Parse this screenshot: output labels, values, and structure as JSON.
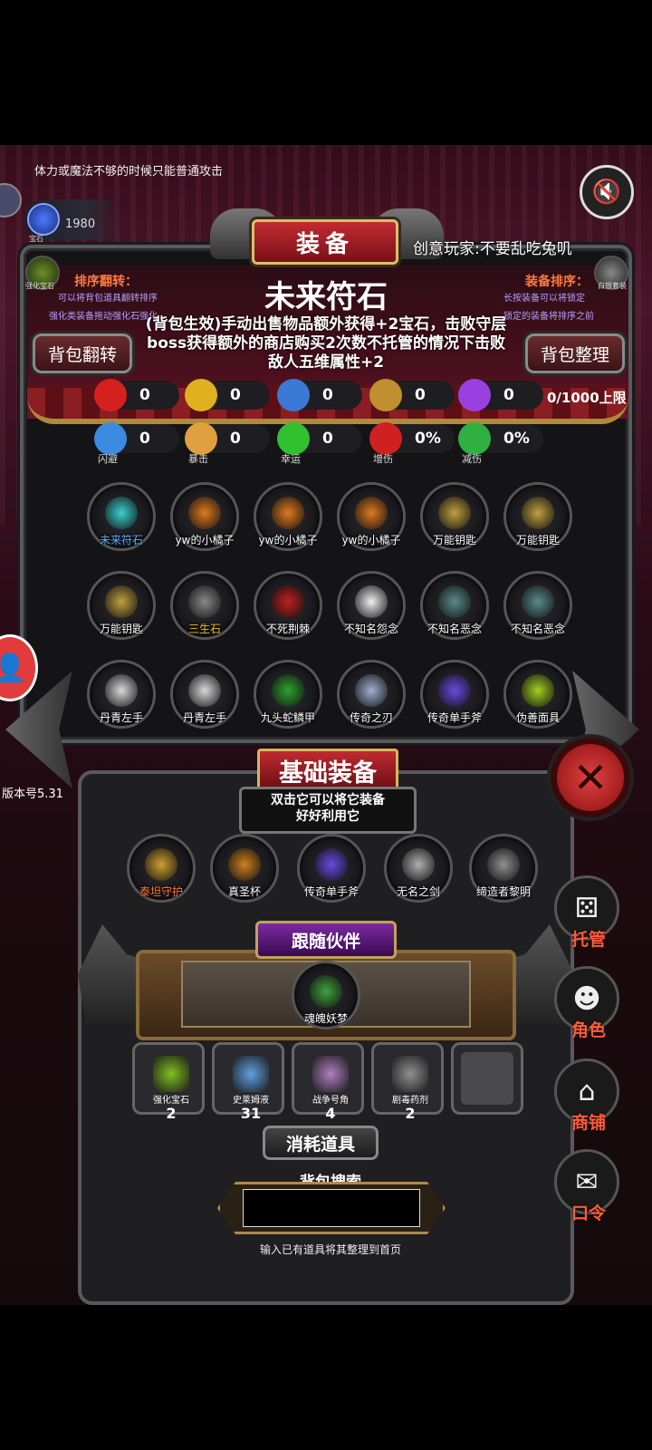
{
  "hint": "体力或魔法不够的时候只能普通攻击",
  "currency": {
    "count": "1980",
    "label": "宝石"
  },
  "creator": "创意玩家:不要乱吃兔叽",
  "title": "装备",
  "left_icon_label": "强化宝石",
  "right_icon_label": "白银套装",
  "sort_flip": {
    "title": "排序翻转：",
    "desc1": "可以将背包道具翻转排序",
    "desc2": "强化类装备拖动强化石强化",
    "button": "背包翻转"
  },
  "sort_equip": {
    "title": "装备排序：",
    "desc1": "长按装备可以将锁定",
    "desc2": "锁定的装备将排序之前",
    "button": "背包整理"
  },
  "selected_item": {
    "name": "未来符石",
    "description": "(背包生效)手动出售物品额外获得+2宝石，击败守层boss获得额外的商店购买2次数不托管的情况下击败敌人五维属性+2"
  },
  "stats_row1": [
    {
      "icon": "heart-icon",
      "value": "0",
      "color": "#d62020"
    },
    {
      "icon": "strength-icon",
      "value": "0",
      "color": "#e0b020"
    },
    {
      "icon": "helmet-icon",
      "value": "0",
      "color": "#3a7ad6"
    },
    {
      "icon": "lyre-icon",
      "value": "0",
      "color": "#c09030"
    },
    {
      "icon": "lightning-icon",
      "value": "0",
      "color": "#9a40e0"
    }
  ],
  "limit": "0/1000上限",
  "stats_row2": [
    {
      "icon": "dodge-icon",
      "value": "0",
      "label": "闪避",
      "color": "#3a8ae0"
    },
    {
      "icon": "crit-icon",
      "value": "0",
      "label": "暴击",
      "color": "#e0a040"
    },
    {
      "icon": "clover-icon",
      "value": "0",
      "label": "幸运",
      "color": "#30c030"
    },
    {
      "icon": "swords-icon",
      "value": "0%",
      "label": "增伤",
      "color": "#d02020"
    },
    {
      "icon": "shield-icon",
      "value": "0%",
      "label": "减伤",
      "color": "#30b040"
    }
  ],
  "inventory": [
    {
      "name": "未来符石",
      "color": "#3ad0d0",
      "label_color": "#5ab0ff"
    },
    {
      "name": "yw的小橘子",
      "color": "#e07a20",
      "label_color": "#ffffff"
    },
    {
      "name": "yw的小橘子",
      "color": "#e07a20",
      "label_color": "#ffffff"
    },
    {
      "name": "yw的小橘子",
      "color": "#e07a20",
      "label_color": "#ffffff"
    },
    {
      "name": "万能钥匙",
      "color": "#c0a040",
      "label_color": "#ffffff"
    },
    {
      "name": "万能钥匙",
      "color": "#c0a040",
      "label_color": "#ffffff"
    },
    {
      "name": "万能钥匙",
      "color": "#c0a040",
      "label_color": "#ffffff"
    },
    {
      "name": "三生石",
      "color": "#888888",
      "label_color": "#f0c020"
    },
    {
      "name": "不死荆棘",
      "color": "#c02020",
      "label_color": "#ffffff"
    },
    {
      "name": "不知名怨念",
      "color": "#f0f0f0",
      "label_color": "#ffffff"
    },
    {
      "name": "不知名恶念",
      "color": "#5a8a8a",
      "label_color": "#ffffff"
    },
    {
      "name": "不知名恶念",
      "color": "#5a8a8a",
      "label_color": "#ffffff"
    },
    {
      "name": "丹青左手",
      "color": "#d8d8d8",
      "label_color": "#ffffff"
    },
    {
      "name": "丹青左手",
      "color": "#d8d8d8",
      "label_color": "#ffffff"
    },
    {
      "name": "九头蛇鳞甲",
      "color": "#30a030",
      "label_color": "#ffffff"
    },
    {
      "name": "传奇之刃",
      "color": "#a0b0d0",
      "label_color": "#ffffff"
    },
    {
      "name": "传奇单手斧",
      "color": "#6a4ae0",
      "label_color": "#ffffff"
    },
    {
      "name": "伪善面具",
      "color": "#a0d020",
      "label_color": "#ffffff"
    }
  ],
  "version": "版本号5.31",
  "basic_equipment": {
    "title": "基础装备",
    "sub1": "双击它可以将它装备",
    "sub2": "好好利用它",
    "items": [
      {
        "name": "泰坦守护",
        "color": "#d0a030",
        "label_color": "#ff7a3a"
      },
      {
        "name": "真圣杯",
        "color": "#d08020",
        "label_color": "#ffffff"
      },
      {
        "name": "传奇单手斧",
        "color": "#6a4ae0",
        "label_color": "#ffffff"
      },
      {
        "name": "无名之剑",
        "color": "#b0b0b0",
        "label_color": "#ffffff"
      },
      {
        "name": "缔造者黎明",
        "color": "#909090",
        "label_color": "#ffffff"
      }
    ]
  },
  "companion": {
    "title": "跟随伙伴",
    "name": "魂魄妖梦",
    "color": "#40a040"
  },
  "consumables": {
    "title": "消耗道具",
    "items": [
      {
        "name": "强化宝石",
        "count": "2",
        "color": "#80c020"
      },
      {
        "name": "史莱姆液",
        "count": "31",
        "color": "#60a0e0"
      },
      {
        "name": "战争号角",
        "count": "4",
        "color": "#b080c0"
      },
      {
        "name": "剧毒药剂",
        "count": "2",
        "color": "#909090"
      }
    ]
  },
  "search": {
    "title": "背包搜索",
    "value": "",
    "hint": "输入已有道具将其整理到首页"
  },
  "side_menu": [
    {
      "label": "托管",
      "icon": "dice-icon"
    },
    {
      "label": "角色",
      "icon": "hooded-figure-icon"
    },
    {
      "label": "商铺",
      "icon": "shop-icon"
    },
    {
      "label": "口令",
      "icon": "scroll-icon"
    }
  ]
}
